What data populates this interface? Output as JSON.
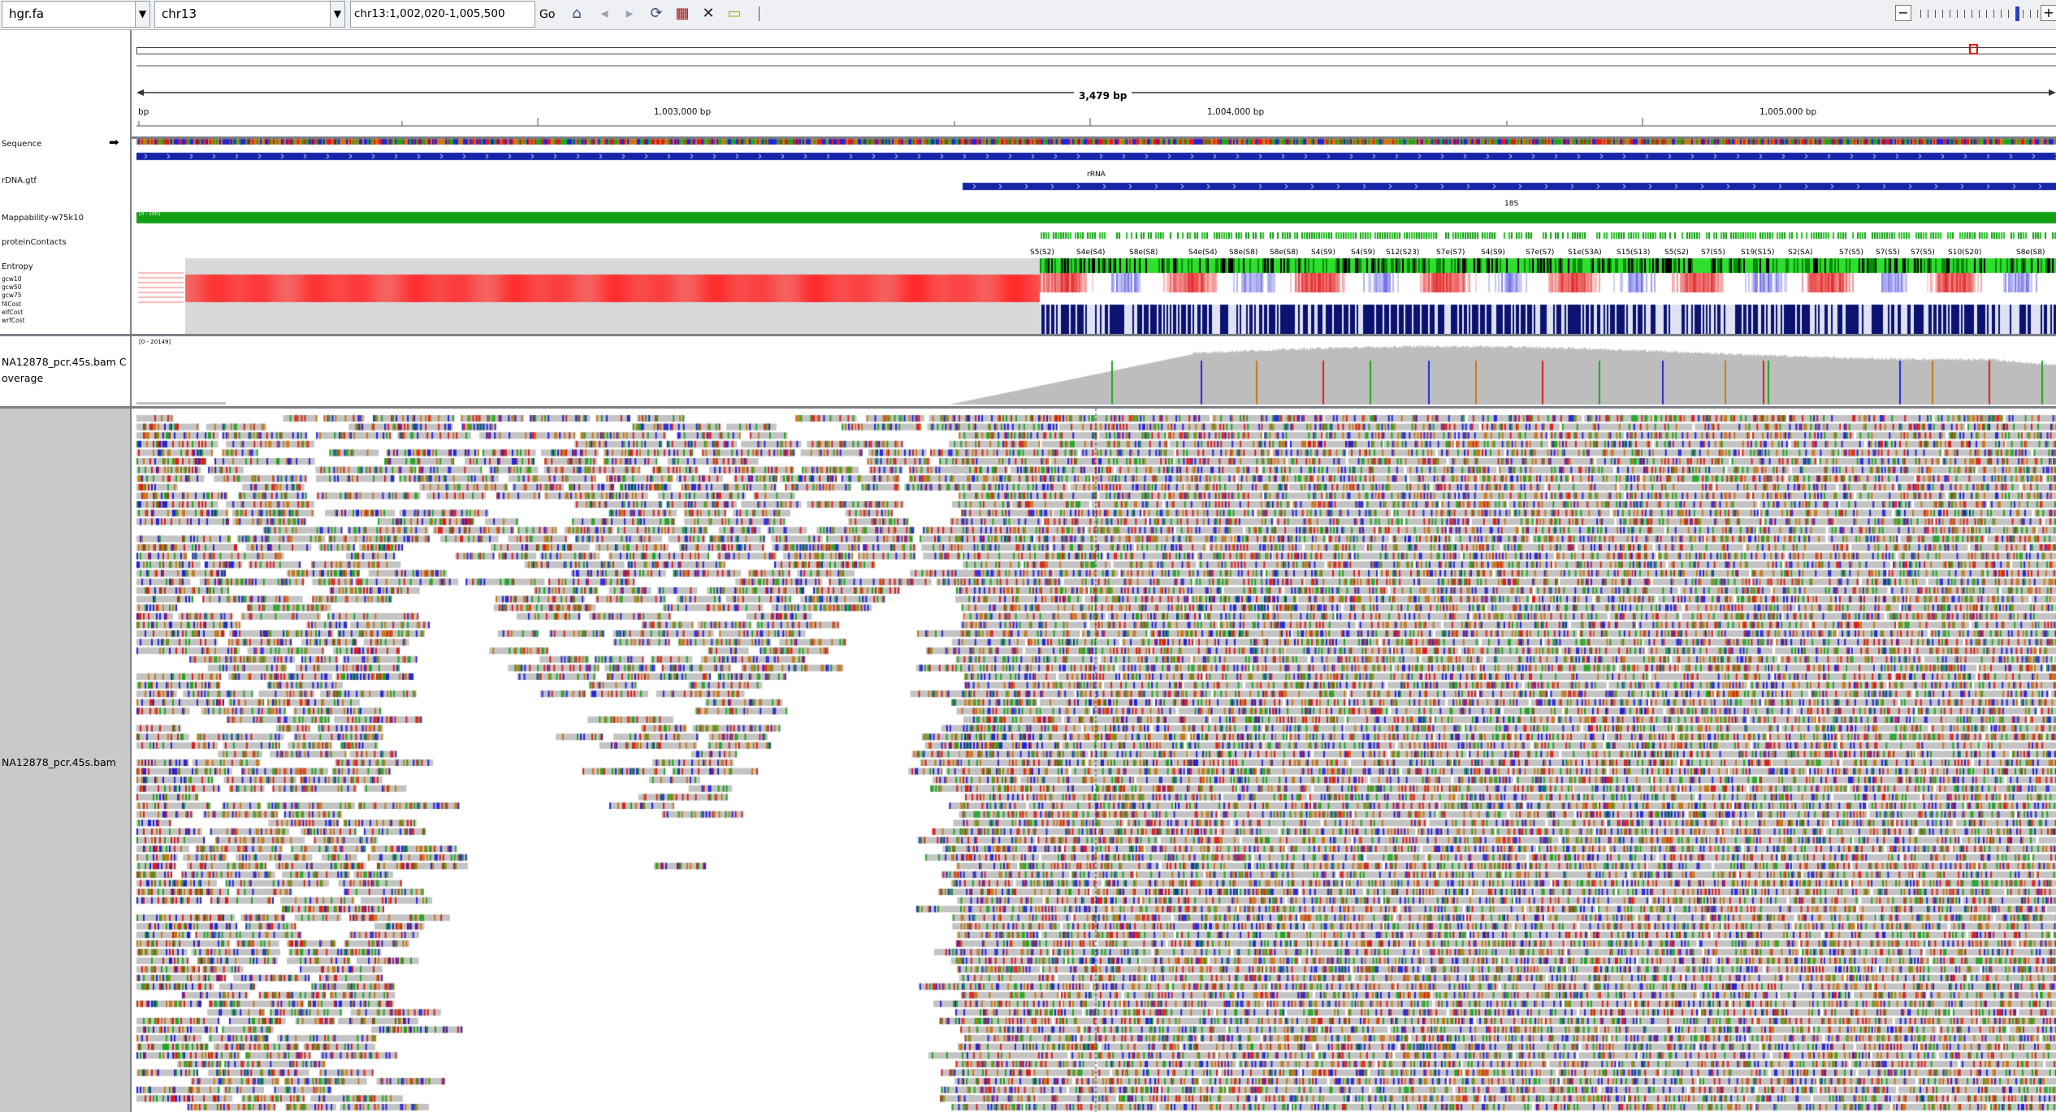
{
  "toolbar": {
    "genome": "hgr.fa",
    "chromosome": "chr13",
    "locus": "chr13:1,002,020-1,005,500",
    "go_label": "Go",
    "icons": [
      "home-icon",
      "back-icon",
      "forward-icon",
      "refresh-icon",
      "region-of-interest-icon",
      "resize-icon",
      "popup-text-icon"
    ],
    "zoom_out": "−",
    "zoom_in": "+",
    "zoom_level": 13,
    "zoom_levels": 17
  },
  "ruler": {
    "start_label": "bp",
    "span_label": "3,479 bp",
    "ticks": [
      "1,003,000 bp",
      "1,004,000 bp",
      "1,005,000 bp"
    ]
  },
  "tracks": {
    "sequence": "Sequence",
    "sequence_strand_arrow": "➡",
    "rdna": "rDNA.gtf",
    "rdna_feature": "rRNA",
    "rdna_subfeature": "18S",
    "mappability": "Mappability-w75k10",
    "mappability_range": "[0 - 100]",
    "protein_contacts": "proteinContacts",
    "entropy": "Entropy",
    "gc_tracks": [
      "gcw10",
      "gcw50",
      "gcw75",
      "f4Cost",
      "eIfCost",
      "wrfCost"
    ],
    "contact_labels": [
      "S5(S2)",
      "S4e(S4)",
      "S8e(S8)",
      "S4e(S4)",
      "S8e(S8)",
      "S8e(S8)",
      "S4(S9)",
      "S4(S9)",
      "S12(S23)",
      "S7e(S7)",
      "S4(S9)",
      "S7e(S7)",
      "S1e(S3A)",
      "S15(S13)",
      "S5(S2)",
      "S7(S5)",
      "S19(S15)",
      "S2(SA)",
      "S7(S5)",
      "S7(S5)",
      "S7(S5)",
      "S10(S20)",
      "S8e(S8)"
    ]
  },
  "coverage": {
    "name": "NA12878_pcr.45s.bam Coverage",
    "range": "[0 - 20149]"
  },
  "alignment": {
    "name": "NA12878_pcr.45s.bam"
  },
  "colors": {
    "read_gray": "#c3c3c3",
    "base_A": "#1fa51f",
    "base_C": "#2424d9",
    "base_G": "#c87818",
    "base_T": "#d91e1e",
    "feature_blue": "#1624a8",
    "mappability_green": "#14a014",
    "entropy_red": "#ff2020"
  }
}
